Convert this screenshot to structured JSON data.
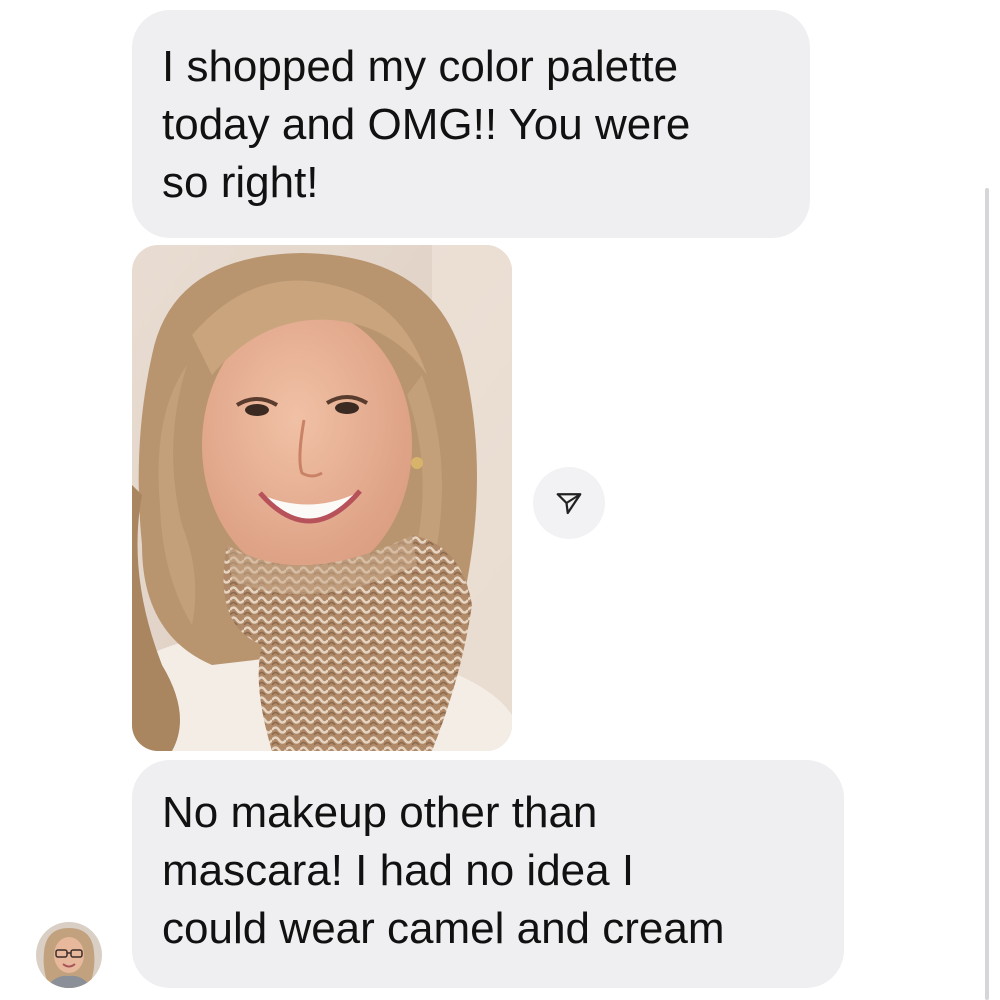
{
  "messages": [
    {
      "lines": [
        "I shopped my color palette",
        "today and OMG!! You were",
        "so right!"
      ]
    },
    {
      "type": "photo",
      "icon": "person-photo"
    },
    {
      "lines": [
        "No makeup other than",
        "mascara! I had no idea I",
        "could wear camel and cream"
      ]
    }
  ],
  "icons": {
    "share": "paper-plane-icon",
    "avatar": "sender-avatar"
  },
  "colors": {
    "bubble": "#efeff1",
    "text": "#111111",
    "background": "#ffffff"
  }
}
